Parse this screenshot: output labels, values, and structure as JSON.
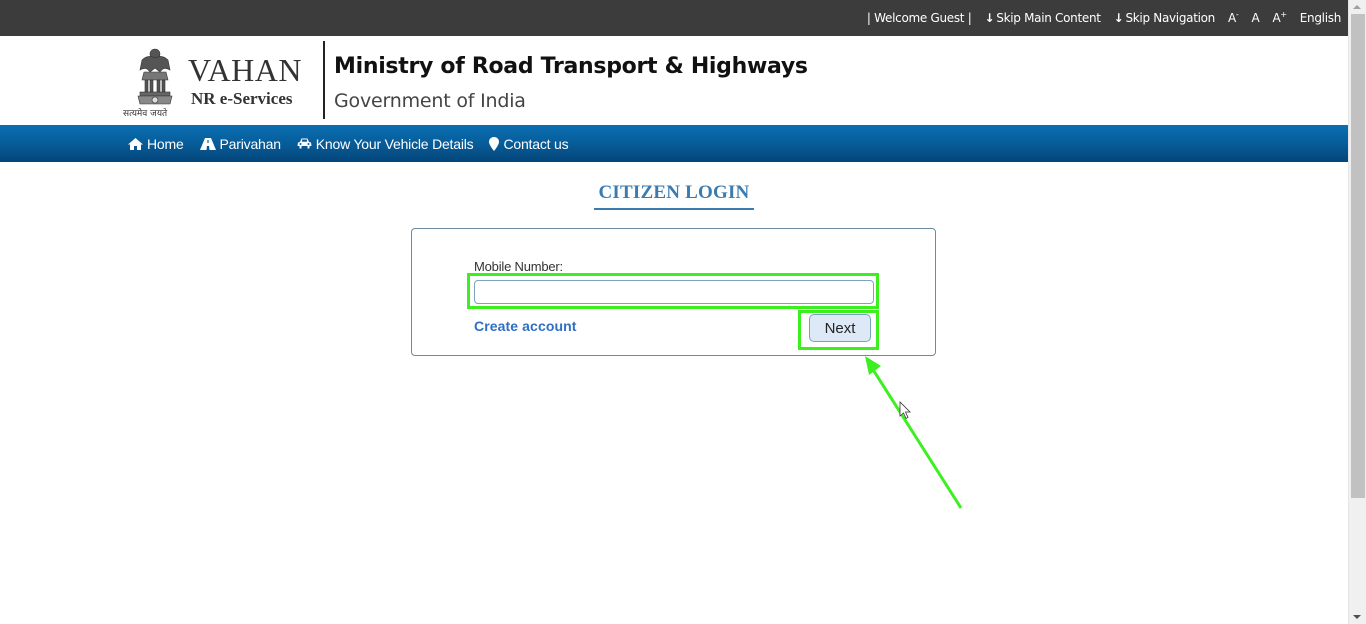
{
  "topbar": {
    "welcome": "| Welcome Guest |",
    "skip_main": "Skip Main Content",
    "skip_nav": "Skip Navigation",
    "font_decrease": "A",
    "font_decrease_sup": "-",
    "font_normal": "A",
    "font_increase": "A",
    "font_increase_sup": "+",
    "language": "English"
  },
  "header": {
    "emblem_motto": "सत्यमेव जयते",
    "brand_title": "VAHAN",
    "brand_subtitle": "NR e-Services",
    "ministry": "Ministry of Road Transport & Highways",
    "government": "Government of India"
  },
  "nav": {
    "items": [
      {
        "label": "Home",
        "icon": "home-icon"
      },
      {
        "label": "Parivahan",
        "icon": "road-icon"
      },
      {
        "label": "Know Your Vehicle Details",
        "icon": "car-icon"
      },
      {
        "label": "Contact us",
        "icon": "map-marker-icon"
      }
    ]
  },
  "login": {
    "title": "CITIZEN LOGIN",
    "mobile_label": "Mobile Number:",
    "mobile_value": "",
    "create_account": "Create account",
    "next_button": "Next"
  },
  "colors": {
    "topbar_bg": "#3c3c3c",
    "nav_bg": "#075c99",
    "title_accent": "#3a7bb0",
    "link": "#2e6fc4",
    "highlight": "#3cf020"
  }
}
